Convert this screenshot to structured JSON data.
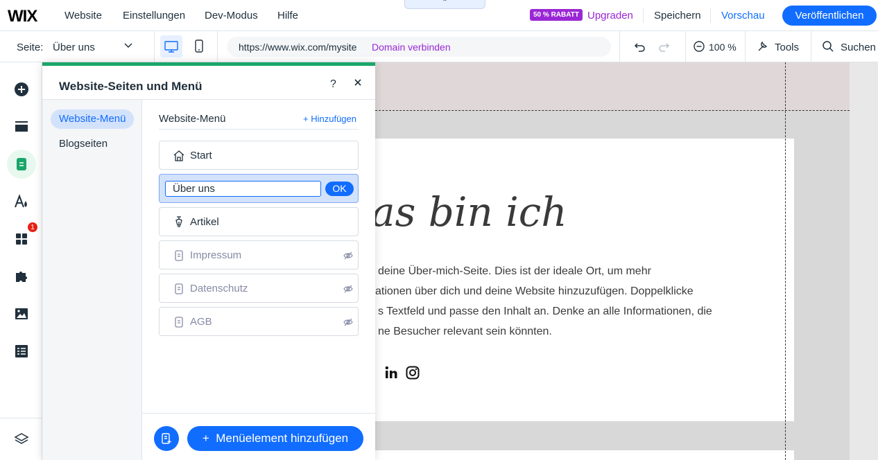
{
  "topbar": {
    "logo": "WIX",
    "nav": [
      "Website",
      "Einstellungen",
      "Dev-Modus",
      "Hilfe"
    ],
    "discount_badge": "50 % RABATT",
    "upgrade": "Upgraden",
    "save": "Speichern",
    "preview": "Vorschau",
    "publish": "Veröffentlichen",
    "collapse_icon": "chevron-up-icon"
  },
  "toolbar": {
    "page_label": "Seite:",
    "page_value": "Über uns",
    "url": "https://www.wix.com/mysite",
    "connect_domain": "Domain verbinden",
    "zoom": "100 %",
    "tools": "Tools",
    "search": "Suchen"
  },
  "rail": {
    "notification_count": "1"
  },
  "panel": {
    "title": "Website-Seiten und Menü",
    "help": "?",
    "nav": [
      "Website-Menü",
      "Blogseiten"
    ],
    "list_title": "Website-Menü",
    "add_link": "Hinzufügen",
    "items": [
      {
        "label": "Start",
        "icon": "home-icon",
        "hidden": false
      },
      {
        "label": "Über uns",
        "icon": "page-icon",
        "editing": true
      },
      {
        "label": "Artikel",
        "icon": "pen-icon",
        "hidden": false
      },
      {
        "label": "Impressum",
        "icon": "page-icon",
        "hidden": true
      },
      {
        "label": "Datenschutz",
        "icon": "page-icon",
        "hidden": true
      },
      {
        "label": "AGB",
        "icon": "page-icon",
        "hidden": true
      }
    ],
    "ok": "OK",
    "add_menu_item": "Menüelement hinzufügen"
  },
  "canvas": {
    "heading": "as bin ich",
    "paragraph": [
      "deine Über-mich-Seite. Dies ist der ideale Ort, um mehr",
      "ationen über dich und deine Website hinzuzufügen. Doppelklicke",
      "s Textfeld und passe den Inhalt an. Denke an alle Informationen, die",
      "ne Besucher relevant sein könnten."
    ]
  },
  "colors": {
    "accent": "#116dff",
    "upgrade": "#9a27d5",
    "panel_top": "#19a66a"
  }
}
